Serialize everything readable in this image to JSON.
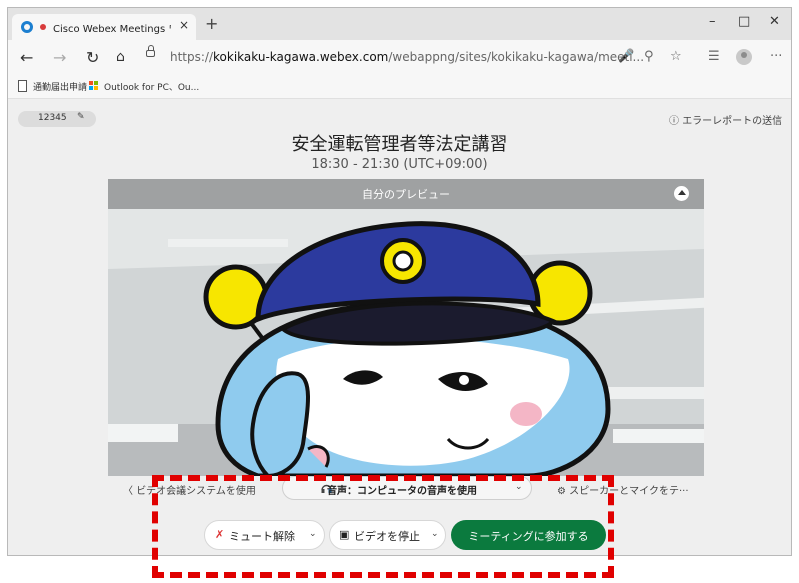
{
  "browser": {
    "tab_title": "Cisco Webex Meetings ウェ",
    "tab_close": "×",
    "new_tab": "+",
    "url_base": "https://",
    "url_host": "kokikaku-kagawa.webex.com",
    "url_path": "/webappng/sites/kokikaku-kagawa/meeti...",
    "more": "···",
    "bookmarks": [
      "通勤届出申請",
      "Outlook for PC、Ou..."
    ]
  },
  "meeting": {
    "id_pill": "12345",
    "error_report": "エラーレポートの送信",
    "title": "安全運転管理者等法定講習",
    "time": "18:30 - 21:30 (UTC+09:00)",
    "preview_label": "自分のプレビュー",
    "video_system": "ビデオ会議システムを使用",
    "audio": "音声：コンピュータの音声を使用",
    "speaker_test": "スピーカーとマイクをテ···",
    "mute_label": "ミュート解除",
    "video_label": "ビデオを停止",
    "join_label": "ミーティングに参加する"
  },
  "colors": {
    "join_button": "#0b7a3e",
    "highlight_dashes": "#e00000",
    "record_dot": "#d83b3b"
  }
}
